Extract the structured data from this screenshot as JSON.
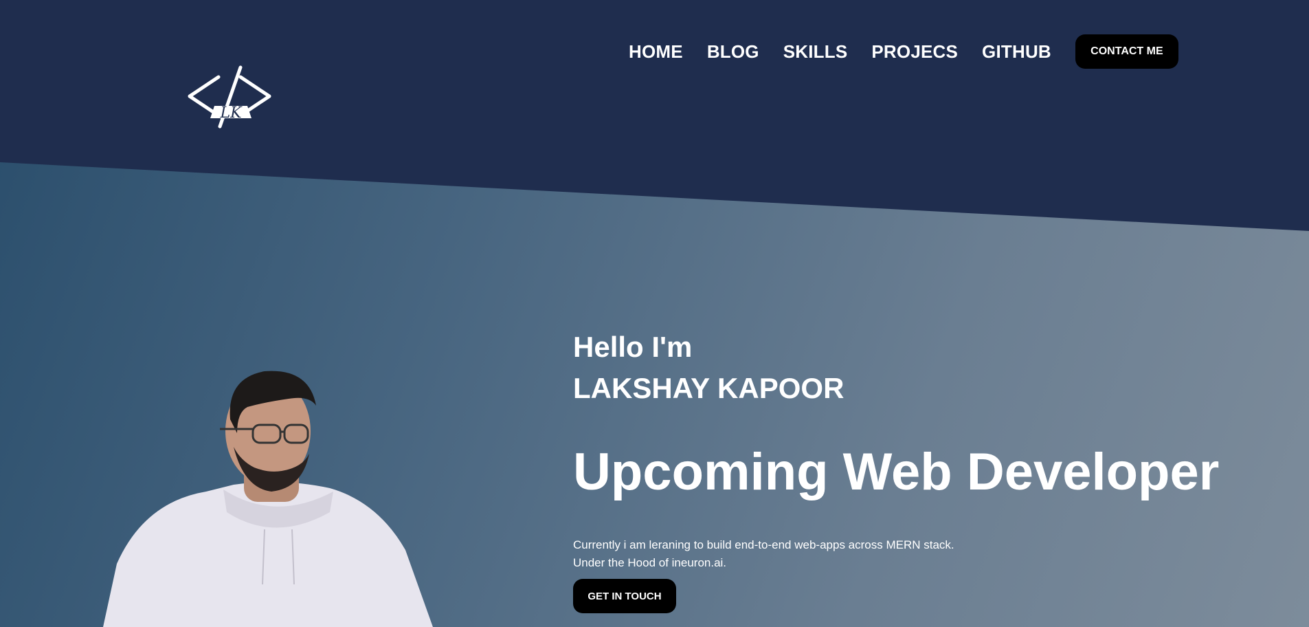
{
  "logo": {
    "text": "LK"
  },
  "nav": {
    "items": [
      "HOME",
      "BLOG",
      "SKILLS",
      "PROJECS",
      "GITHUB"
    ],
    "contact_label": "CONTACT ME"
  },
  "hero": {
    "greeting": "Hello I'm",
    "name": "LAKSHAY KAPOOR",
    "role": "Upcoming Web Developer",
    "description_line1": "Currently i am leraning to build end-to-end web-apps across MERN stack.",
    "description_line2": "Under the Hood of ineuron.ai.",
    "cta_label": "GET IN TOUCH"
  },
  "colors": {
    "header_bg": "#1f2d4e",
    "button_bg": "#000000",
    "text": "#ffffff"
  }
}
